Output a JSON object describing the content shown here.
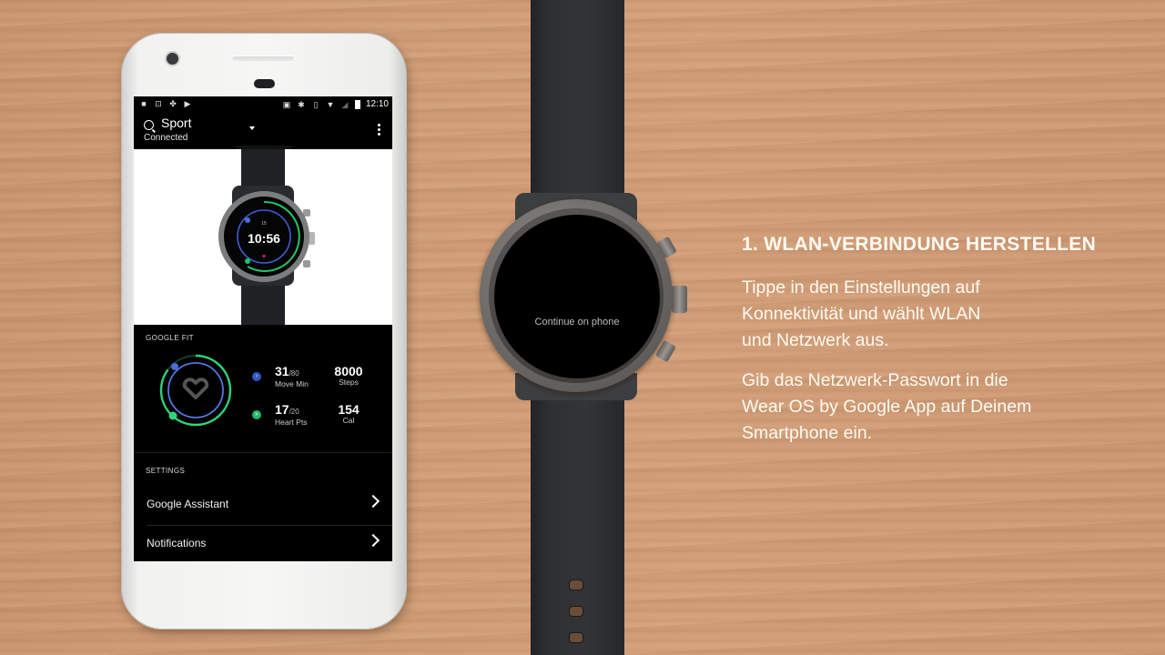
{
  "phone": {
    "status_bar": {
      "left_icons": [
        "video-icon",
        "screenshot-icon",
        "pinwheel-icon",
        "play-store-icon"
      ],
      "right_icons": [
        "cast-icon",
        "bluetooth-icon",
        "vibrate-icon",
        "wifi-icon",
        "no-signal-icon",
        "battery-icon"
      ],
      "time": "12:10"
    },
    "app_bar": {
      "title": "Sport",
      "subtitle": "Connected"
    },
    "watch_preview": {
      "time": "10:56"
    },
    "google_fit": {
      "section_label": "GOOGLE FIT",
      "move_min": {
        "value": "31",
        "goal": "/80",
        "label": "Move Min",
        "color": "#4a6fd8"
      },
      "heart_pts": {
        "value": "17",
        "goal": "/20",
        "label": "Heart Pts",
        "color": "#2ed47a"
      },
      "steps": {
        "value": "8000",
        "label": "Steps"
      },
      "calories": {
        "value": "154",
        "label": "Cal"
      },
      "move_progress": 0.3875,
      "heart_progress": 0.85
    },
    "settings": {
      "section_label": "SETTINGS",
      "items": [
        {
          "label": "Google Assistant"
        },
        {
          "label": "Notifications"
        }
      ]
    }
  },
  "watch": {
    "screen_message": "Continue on phone"
  },
  "instructions": {
    "heading": "1. WLAN-VERBINDUNG HERSTELLEN",
    "paragraph1": [
      "Tippe in den Einstellungen auf",
      "Konnektivität und wählt WLAN",
      "und Netzwerk aus."
    ],
    "paragraph2": [
      "Gib das Netzwerk-Passwort in die",
      "Wear OS by Google App auf Deinem",
      "Smartphone ein."
    ]
  }
}
